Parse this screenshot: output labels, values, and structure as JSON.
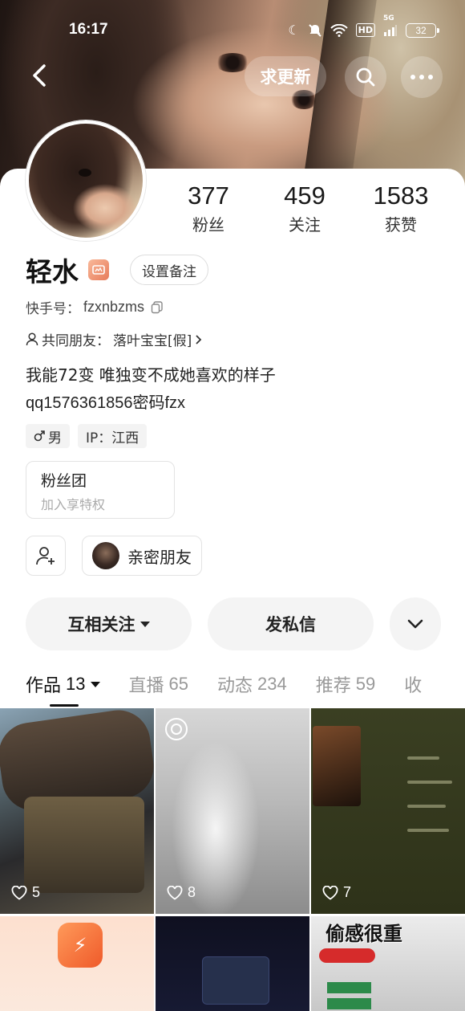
{
  "status_bar": {
    "time": "16:17",
    "hd": "HD",
    "network": "5G",
    "battery": "32"
  },
  "header": {
    "request_update": "求更新"
  },
  "profile": {
    "stats": [
      {
        "num": "377",
        "label": "粉丝"
      },
      {
        "num": "459",
        "label": "关注"
      },
      {
        "num": "1583",
        "label": "获赞"
      }
    ],
    "name": "轻水",
    "set_remark": "设置备注",
    "kuaishou_id_label": "快手号：",
    "kuaishou_id": "fzxnbzms",
    "mutual_friends_label": "共同朋友：",
    "mutual_friends": "落叶宝宝[假]",
    "bio_line1": "我能72变 唯独变不成她喜欢的样子",
    "bio_line2": "qq1576361856密码fzx",
    "gender": "男",
    "ip": "IP：江西",
    "fan_group_title": "粉丝团",
    "fan_group_sub": "加入享特权",
    "close_friend": "亲密朋友",
    "mutual_follow": "互相关注",
    "send_message": "发私信"
  },
  "tabs": [
    {
      "label": "作品",
      "count": "13"
    },
    {
      "label": "直播",
      "count": "65"
    },
    {
      "label": "动态",
      "count": "234"
    },
    {
      "label": "推荐",
      "count": "59"
    },
    {
      "label": "收",
      "count": ""
    }
  ],
  "grid": [
    {
      "likes": "5"
    },
    {
      "likes": "8"
    },
    {
      "likes": "7"
    },
    {
      "title": ""
    },
    {
      "title": ""
    },
    {
      "title": "偷感很重"
    }
  ],
  "colors": {
    "accent_dark": "#111111",
    "button_bg": "#f4f4f4",
    "tab_inactive": "#999999"
  }
}
